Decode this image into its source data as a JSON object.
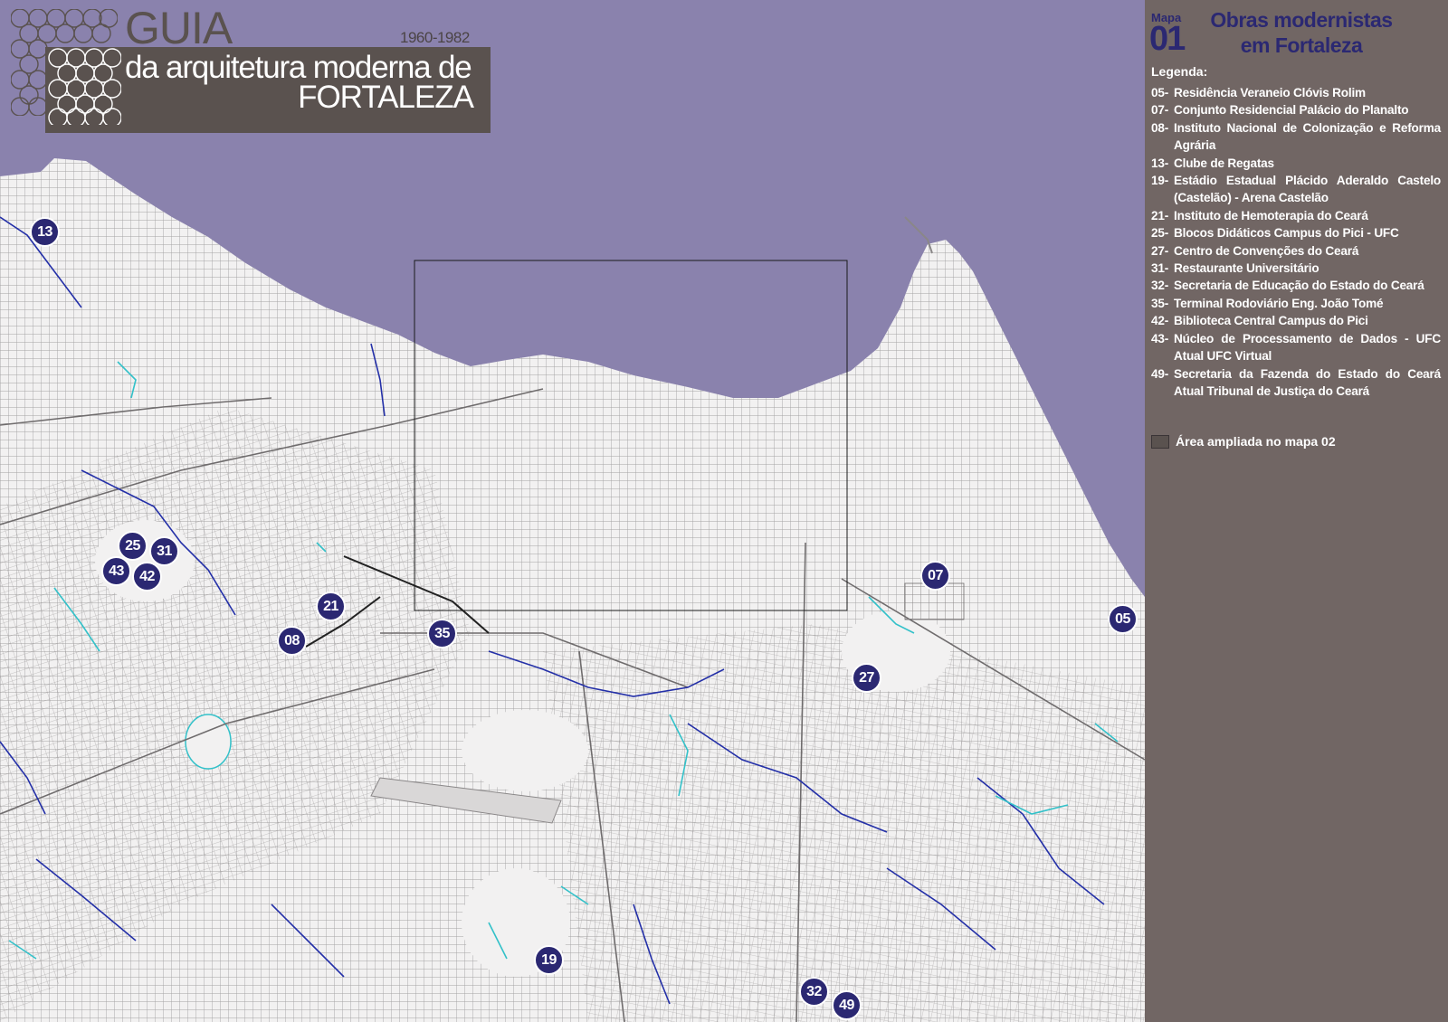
{
  "logo": {
    "guia": "GUIA",
    "years": "1960-1982",
    "line1": "da arquitetura moderna de",
    "line2": "FORTALEZA"
  },
  "panel": {
    "mapa_label": "Mapa",
    "mapa_number": "01",
    "title_line1": "Obras modernistas",
    "title_line2": "em Fortaleza",
    "legend_title": "Legenda:",
    "items": [
      {
        "num": "05-",
        "text": "Residência Veraneio Clóvis Rolim"
      },
      {
        "num": "07-",
        "text": "Conjunto Residencial Palácio do Planalto"
      },
      {
        "num": "08-",
        "text": "Instituto Nacional de Colonização e Reforma Agrária"
      },
      {
        "num": "13-",
        "text": "Clube de Regatas"
      },
      {
        "num": "19-",
        "text": "Estádio Estadual Plácido Aderaldo Castelo (Castelão) - Arena Castelão"
      },
      {
        "num": "21-",
        "text": "Instituto de Hemoterapia do Ceará"
      },
      {
        "num": "25-",
        "text": "Blocos Didáticos Campus do Pici - UFC"
      },
      {
        "num": "27-",
        "text": "Centro de Convenções do Ceará"
      },
      {
        "num": "31-",
        "text": "Restaurante Universitário"
      },
      {
        "num": "32-",
        "text": "Secretaria de Educação do Estado do Ceará"
      },
      {
        "num": "35-",
        "text": "Terminal Rodoviário Eng. João Tomé"
      },
      {
        "num": "42-",
        "text": "Biblioteca Central Campus do Pici"
      },
      {
        "num": "43-",
        "text": "Núcleo de Processamento de Dados - UFC Atual UFC Virtual"
      },
      {
        "num": "49-",
        "text": "Secretaria da Fazenda do Estado do Ceará Atual Tribunal de Justiça do Ceará"
      }
    ],
    "area_label": "Área ampliada no mapa 02"
  },
  "markers": [
    "05",
    "07",
    "08",
    "13",
    "19",
    "21",
    "25",
    "27",
    "31",
    "32",
    "35",
    "42",
    "43",
    "49"
  ],
  "colors": {
    "sea": "#8a82ad",
    "land": "#f2f1f1",
    "streets": "#8a8788",
    "marker": "#2b2872",
    "panel": "#716664",
    "rivers": "#2430a8",
    "lagoons": "#33c1c9"
  }
}
